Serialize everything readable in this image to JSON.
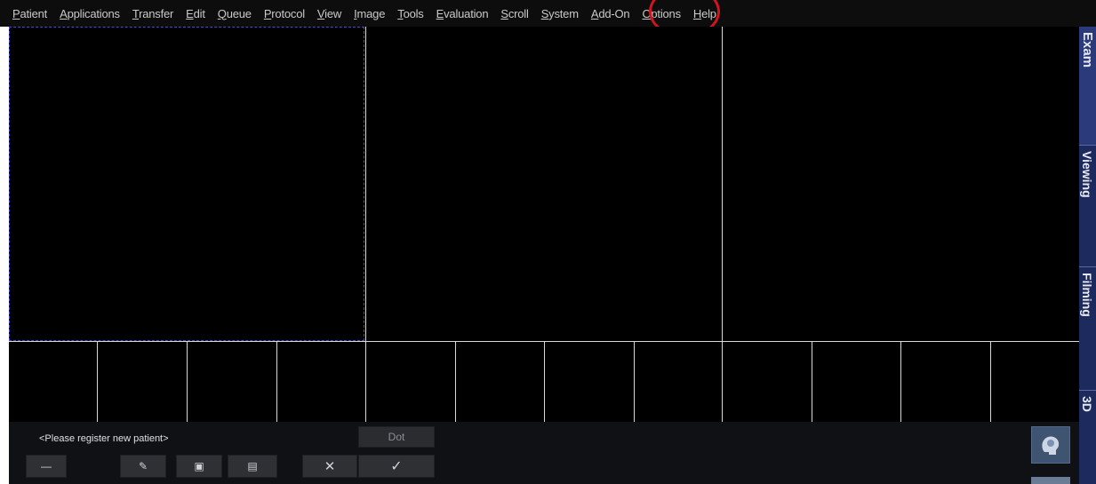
{
  "menubar": {
    "items": [
      {
        "mnemonic": "P",
        "rest": "atient"
      },
      {
        "mnemonic": "A",
        "rest": "pplications"
      },
      {
        "mnemonic": "T",
        "rest": "ransfer"
      },
      {
        "mnemonic": "E",
        "rest": "dit"
      },
      {
        "mnemonic": "Q",
        "rest": "ueue"
      },
      {
        "mnemonic": "P",
        "rest": "rotocol"
      },
      {
        "mnemonic": "V",
        "rest": "iew"
      },
      {
        "mnemonic": "I",
        "rest": "mage"
      },
      {
        "mnemonic": "T",
        "rest": "ools"
      },
      {
        "mnemonic": "E",
        "rest": "valuation"
      },
      {
        "mnemonic": "S",
        "rest": "croll"
      },
      {
        "mnemonic": "S",
        "rest": "ystem"
      },
      {
        "mnemonic": "A",
        "rest": "dd-On"
      },
      {
        "mnemonic": "O",
        "rest": "ptions"
      },
      {
        "mnemonic": "H",
        "rest": "elp"
      }
    ],
    "highlighted_item": "System",
    "highlight_color": "#d1141d"
  },
  "side_tabs": [
    {
      "label": "Exam",
      "active": true
    },
    {
      "label": "Viewing",
      "active": false
    },
    {
      "label": "Filming",
      "active": false
    },
    {
      "label": "3D",
      "active": false
    }
  ],
  "panel": {
    "patient_label": "<Please register new patient>",
    "dot_button": "Dot",
    "buttons": [
      {
        "name": "minus-button",
        "icon": "minus-icon",
        "glyph": "—"
      },
      {
        "name": "pen-button",
        "icon": "pen-icon",
        "glyph": "✎"
      },
      {
        "name": "camera-button",
        "icon": "camera-icon",
        "glyph": "▣"
      },
      {
        "name": "document-button",
        "icon": "document-icon",
        "glyph": "▤"
      },
      {
        "name": "cancel-button",
        "icon": "close-icon",
        "glyph": "✕"
      },
      {
        "name": "confirm-button",
        "icon": "checkmark-icon",
        "glyph": "✓"
      }
    ],
    "right_button_icon": "head-scan-icon"
  },
  "colors": {
    "menubar_bg": "#0d0d0d",
    "viewport_bg": "#000000",
    "active_frame": "#4a4ad8",
    "side_tab_bg": "#1c2a5e"
  }
}
